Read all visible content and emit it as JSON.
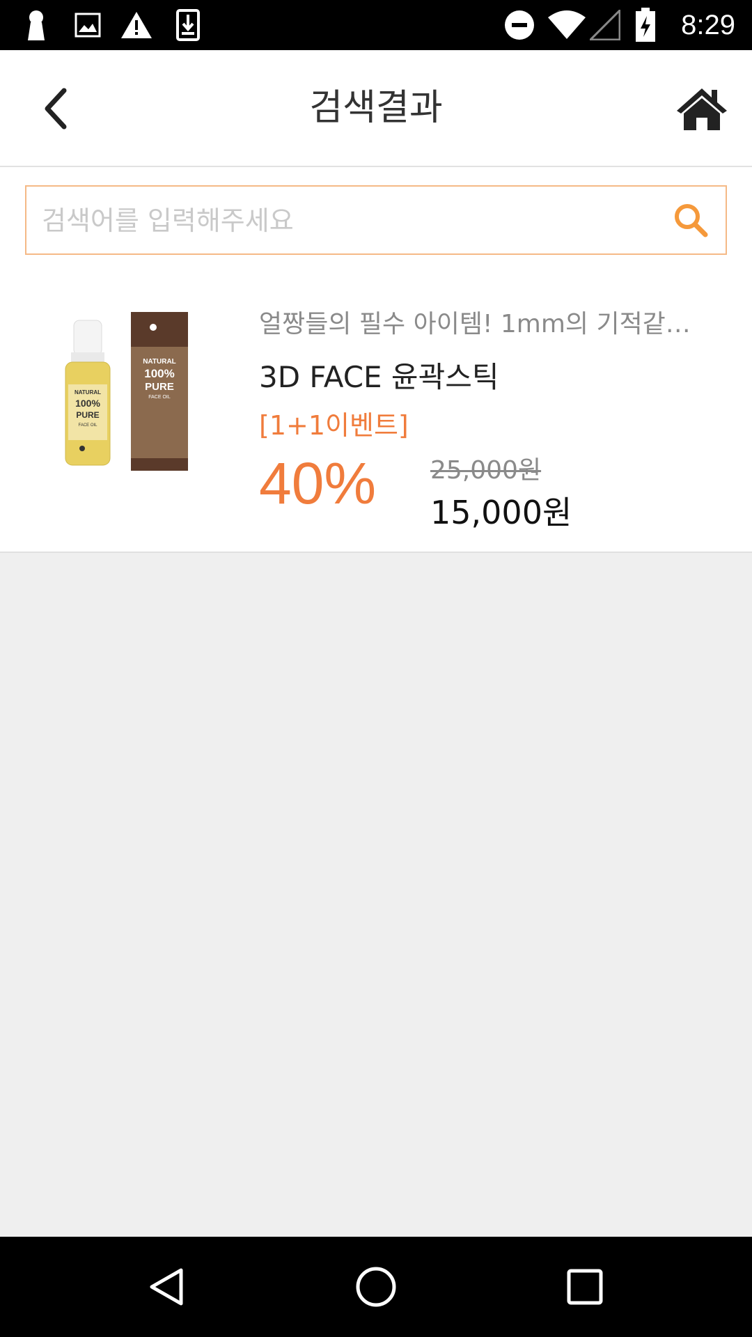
{
  "status_bar": {
    "time": "8:29",
    "icons": [
      "keyhole-icon",
      "image-icon",
      "warning-icon",
      "download-icon",
      "dnd-icon",
      "wifi-icon",
      "signal-icon",
      "battery-charging-icon"
    ]
  },
  "header": {
    "title": "검색결과",
    "back_icon": "chevron-left-icon",
    "home_icon": "home-icon"
  },
  "search": {
    "placeholder": "검색어를 입력해주세요",
    "value": "",
    "button_icon": "search-icon",
    "accent": "#f5993b"
  },
  "results": [
    {
      "description": "얼짱들의 필수 아이템! 1mm의 기적같…",
      "name": "3D FACE 윤곽스틱",
      "event_label": "[1+1이벤트]",
      "discount": "40%",
      "original_price": "25,000원",
      "sale_price": "15,000원",
      "image_label": "face-oil-product-image"
    }
  ],
  "nav_bar": {
    "back_icon": "triangle-back-icon",
    "home_icon": "circle-home-icon",
    "recents_icon": "square-recents-icon"
  },
  "colors": {
    "accent_orange": "#f07c3c",
    "search_border": "#f5b986"
  }
}
